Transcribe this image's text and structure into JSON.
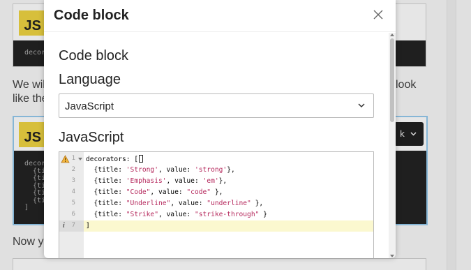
{
  "background": {
    "badge_label": "JS",
    "snippet_top": "decor",
    "text_line1": "We will",
    "text_line2": "like the",
    "text_right": "look",
    "text_bottom": "Now yo",
    "snippet_lines": [
      "decor",
      "  {ti",
      "  {ti",
      "  {ti",
      "  {ti",
      "  {ti",
      "]"
    ],
    "mini_button_label": "k"
  },
  "dialog": {
    "title": "Code block",
    "section_heading": "Code block",
    "language_label": "Language",
    "language_value": "JavaScript",
    "code_label": "JavaScript"
  },
  "editor": {
    "lines": [
      {
        "num": "1",
        "parts": [
          {
            "t": "decorators: [",
            "c": "k"
          }
        ],
        "cursor": true,
        "warn": true,
        "fold": true
      },
      {
        "num": "2",
        "parts": [
          {
            "t": "  {title: ",
            "c": "k"
          },
          {
            "t": "'Strong'",
            "c": "s"
          },
          {
            "t": ", value: ",
            "c": "k"
          },
          {
            "t": "'strong'",
            "c": "s"
          },
          {
            "t": "},",
            "c": "k"
          }
        ]
      },
      {
        "num": "3",
        "parts": [
          {
            "t": "  {title: ",
            "c": "k"
          },
          {
            "t": "'Emphasis'",
            "c": "s"
          },
          {
            "t": ", value: ",
            "c": "k"
          },
          {
            "t": "'em'",
            "c": "s"
          },
          {
            "t": "},",
            "c": "k"
          }
        ]
      },
      {
        "num": "4",
        "parts": [
          {
            "t": "  {title: ",
            "c": "k"
          },
          {
            "t": "\"Code\"",
            "c": "s"
          },
          {
            "t": ", value: ",
            "c": "k"
          },
          {
            "t": "\"code\"",
            "c": "s"
          },
          {
            "t": " },",
            "c": "k"
          }
        ]
      },
      {
        "num": "5",
        "parts": [
          {
            "t": "  {title: ",
            "c": "k"
          },
          {
            "t": "\"Underline\"",
            "c": "s"
          },
          {
            "t": ", value: ",
            "c": "k"
          },
          {
            "t": "\"underline\"",
            "c": "s"
          },
          {
            "t": " },",
            "c": "k"
          }
        ]
      },
      {
        "num": "6",
        "parts": [
          {
            "t": "  {title: ",
            "c": "k"
          },
          {
            "t": "\"Strike\"",
            "c": "s"
          },
          {
            "t": ", value: ",
            "c": "k"
          },
          {
            "t": "\"strike-through\"",
            "c": "s"
          },
          {
            "t": " }",
            "c": "k"
          }
        ]
      },
      {
        "num": "7",
        "parts": [
          {
            "t": "]",
            "c": "k"
          }
        ],
        "active": true,
        "info": true
      }
    ]
  },
  "colors": {
    "string": "#b5285c",
    "active_line": "#fbf8cf",
    "badge": "#d7bf3b",
    "focus_border": "#86b6d6"
  },
  "icons": {
    "close": "close-icon",
    "dropdown": "chevron-down-icon",
    "warning": "warning-icon",
    "info": "info-icon"
  }
}
